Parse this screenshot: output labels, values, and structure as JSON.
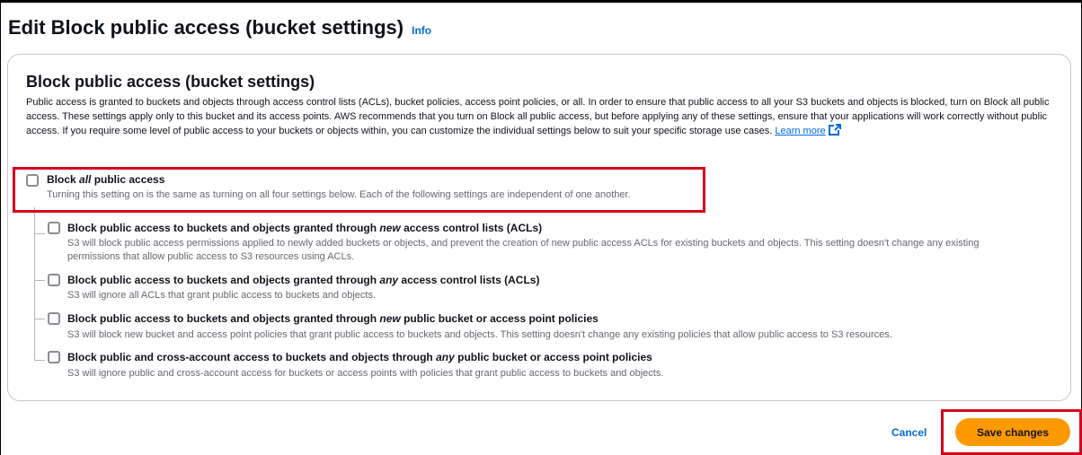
{
  "header": {
    "title": "Edit Block public access (bucket settings)",
    "info_link": "Info"
  },
  "section": {
    "title": "Block public access (bucket settings)",
    "description": "Public access is granted to buckets and objects through access control lists (ACLs), bucket policies, access point policies, or all. In order to ensure that public access to all your S3 buckets and objects is blocked, turn on Block all public access. These settings apply only to this bucket and its access points. AWS recommends that you turn on Block all public access, but before applying any of these settings, ensure that your applications will work correctly without public access. If you require some level of public access to your buckets or objects within, you can customize the individual settings below to suit your specific storage use cases.",
    "learn_more": "Learn more"
  },
  "block_all": {
    "label_pre": "Block ",
    "label_em": "all",
    "label_post": " public access",
    "description": "Turning this setting on is the same as turning on all four settings below. Each of the following settings are independent of one another.",
    "checked": false
  },
  "options": [
    {
      "label_pre": "Block public access to buckets and objects granted through ",
      "label_em": "new",
      "label_post": " access control lists (ACLs)",
      "description": "S3 will block public access permissions applied to newly added buckets or objects, and prevent the creation of new public access ACLs for existing buckets and objects. This setting doesn't change any existing permissions that allow public access to S3 resources using ACLs.",
      "checked": false
    },
    {
      "label_pre": "Block public access to buckets and objects granted through ",
      "label_em": "any",
      "label_post": " access control lists (ACLs)",
      "description": "S3 will ignore all ACLs that grant public access to buckets and objects.",
      "checked": false
    },
    {
      "label_pre": "Block public access to buckets and objects granted through ",
      "label_em": "new",
      "label_post": " public bucket or access point policies",
      "description": "S3 will block new bucket and access point policies that grant public access to buckets and objects. This setting doesn't change any existing policies that allow public access to S3 resources.",
      "checked": false
    },
    {
      "label_pre": "Block public and cross-account access to buckets and objects through ",
      "label_em": "any",
      "label_post": " public bucket or access point policies",
      "description": "S3 will ignore public and cross-account access for buckets or access points with policies that grant public access to buckets and objects.",
      "checked": false
    }
  ],
  "footer": {
    "cancel_label": "Cancel",
    "save_label": "Save changes"
  },
  "colors": {
    "accent_link": "#006ce0",
    "primary_button": "#ff9900",
    "highlight_border": "#d6001c"
  },
  "icons": [
    "external-link-icon",
    "checkbox-icon"
  ]
}
